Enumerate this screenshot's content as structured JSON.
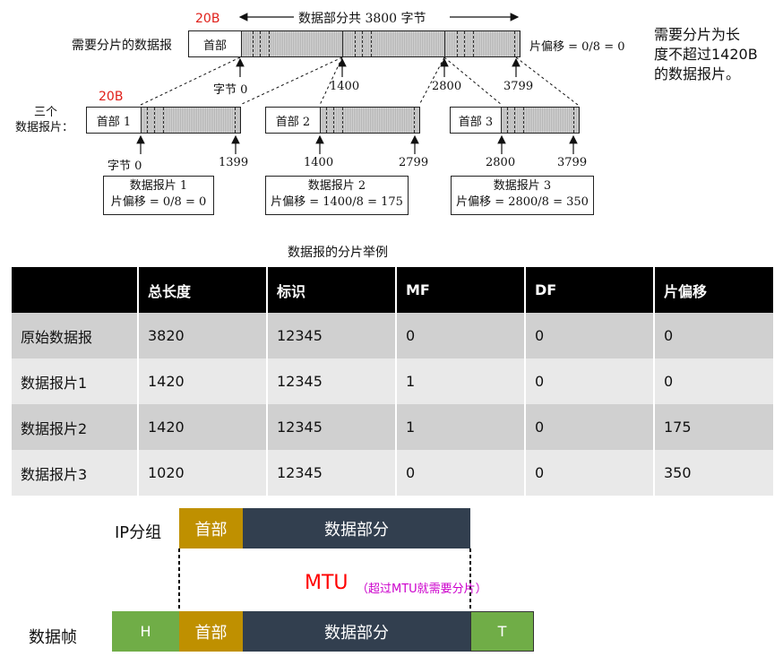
{
  "diagram": {
    "total_label": "数据部分共 3800 字节",
    "orig_header_size": "20B",
    "orig_row_label": "需要分片的数据报",
    "header": "首部",
    "orig_offset": "片偏移 = 0/8 = 0",
    "byte0": "字节 0",
    "b1400": "1400",
    "b2800": "2800",
    "b3799": "3799",
    "frag_header_size": "20B",
    "three_frags": "三个",
    "frags_label": "数据报片：",
    "h1": "首部 1",
    "h2": "首部 2",
    "h3": "首部 3",
    "f1_start": "字节 0",
    "f1_end": "1399",
    "f2_start": "1400",
    "f2_end": "2799",
    "f3_start": "2800",
    "f3_end": "3799",
    "info1": [
      "数据报片 1",
      "片偏移 = 0/8 = 0"
    ],
    "info2": [
      "数据报片 2",
      "片偏移 = 1400/8 = 175"
    ],
    "info3": [
      "数据报片 3",
      "片偏移 = 2800/8 = 350"
    ],
    "caption": "数据报的分片举例",
    "note": [
      "需要分片为长",
      "度不超过1420B",
      "的数据报片。"
    ]
  },
  "table": {
    "headers": [
      "",
      "总长度",
      "标识",
      "MF",
      "DF",
      "片偏移"
    ],
    "rows": [
      [
        "原始数据报",
        "3820",
        "12345",
        "0",
        "0",
        "0"
      ],
      [
        "数据报片1",
        "1420",
        "12345",
        "1",
        "0",
        "0"
      ],
      [
        "数据报片2",
        "1420",
        "12345",
        "1",
        "0",
        "175"
      ],
      [
        "数据报片3",
        "1020",
        "12345",
        "0",
        "0",
        "350"
      ]
    ]
  },
  "mtu": {
    "ip_label": "IP分组",
    "header": "首部",
    "data": "数据部分",
    "mtu": "MTU",
    "mtu_note": "（超过MTU就需要分片）",
    "frame_label": "数据帧",
    "h": "H",
    "t": "T"
  },
  "colors": {
    "header_gold": "#bf9000",
    "data_navy": "#323f4f",
    "frame_green": "#70ad47",
    "mtu_red": "#ff0000",
    "note_magenta": "#cc00cc"
  }
}
